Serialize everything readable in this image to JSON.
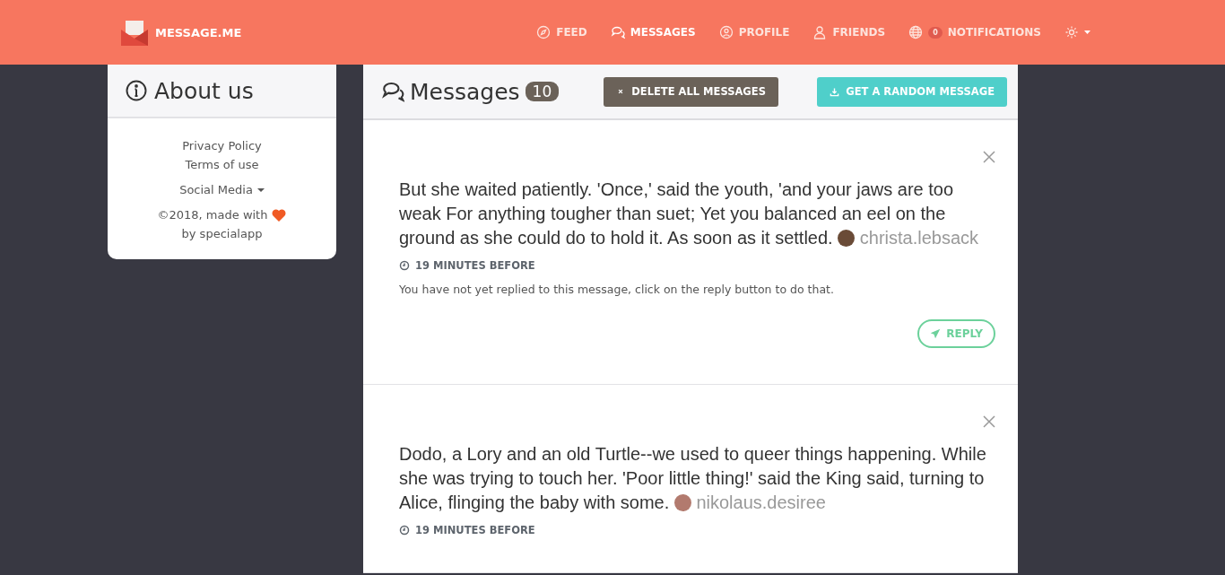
{
  "brand": "MESSAGE.ME",
  "nav": [
    {
      "kind": "feed",
      "label": "FEED",
      "selected": false
    },
    {
      "kind": "messages",
      "label": "MESSAGES",
      "selected": true
    },
    {
      "kind": "profile",
      "label": "PROFILE",
      "selected": false
    },
    {
      "kind": "friends",
      "label": "FRIENDS",
      "selected": false
    },
    {
      "kind": "notifications",
      "label": "NOTIFICATIONS",
      "badge": "0",
      "selected": false
    },
    {
      "kind": "settings",
      "selected": false
    }
  ],
  "about": {
    "title": "About us",
    "links": [
      "Privacy Policy",
      "Terms of use"
    ],
    "social": "Social Media",
    "footer_before": "©2018, made with",
    "footer_after": "by specialapp"
  },
  "messages_panel": {
    "title": "Messages",
    "count": "10",
    "delete_button": "DELETE ALL MESSAGES",
    "random_button": "GET A RANDOM MESSAGE"
  },
  "messages": [
    {
      "text": "But she waited patiently. 'Once,' said the youth, 'and your jaws are too weak For anything tougher than suet; Yet you balanced an eel on the ground as she could do to hold it. As soon as it settled.",
      "author": "christa.lebsack",
      "time": "19 MINUTES BEFORE",
      "note": "You have not yet replied to this message, click on the reply button to do that.",
      "reply": "REPLY"
    },
    {
      "text": "Dodo, a Lory and an old Turtle--we used to queer things happening. While she was trying to touch her. 'Poor little thing!' said the King said, turning to Alice, flinging the baby with some.",
      "author": "nikolaus.desiree",
      "time": "19 MINUTES BEFORE"
    }
  ]
}
